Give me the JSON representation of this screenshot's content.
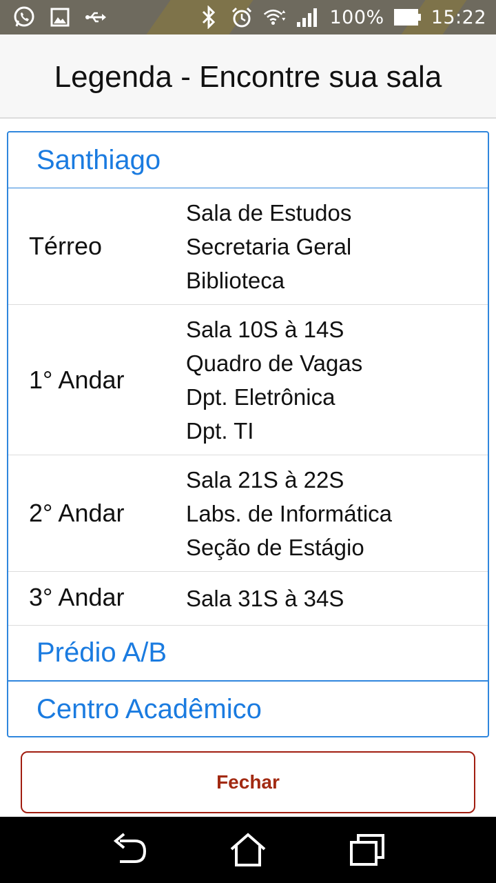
{
  "status_bar": {
    "icons_left": [
      "whatsapp-icon",
      "image-icon",
      "usb-icon"
    ],
    "icons_right": [
      "bluetooth-icon",
      "alarm-icon",
      "wifi-icon",
      "signal-icon",
      "battery-icon"
    ],
    "battery_percent": "100%",
    "time": "15:22"
  },
  "header": {
    "title": "Legenda - Encontre sua sala"
  },
  "accordion": {
    "sections": [
      {
        "title": "Santhiago",
        "expanded": true,
        "floors": [
          {
            "name": "Térreo",
            "rooms": [
              "Sala de Estudos",
              "Secretaria Geral",
              "Biblioteca"
            ]
          },
          {
            "name": "1° Andar",
            "rooms": [
              "Sala 10S à 14S",
              "Quadro de Vagas",
              "Dpt. Eletrônica",
              "Dpt. TI"
            ]
          },
          {
            "name": "2° Andar",
            "rooms": [
              "Sala 21S à 22S",
              "Labs. de Informática",
              "Seção de Estágio"
            ]
          },
          {
            "name": "3° Andar",
            "rooms": [
              "Sala 31S à 34S"
            ]
          }
        ]
      },
      {
        "title": "Prédio A/B",
        "expanded": false
      },
      {
        "title": "Centro Acadêmico",
        "expanded": false
      }
    ]
  },
  "close_button": {
    "label": "Fechar"
  },
  "nav_bar": {
    "icons": [
      "back-icon",
      "home-icon",
      "recent-apps-icon"
    ]
  },
  "colors": {
    "accent_blue": "#1a7be0",
    "close_red": "#a22a12",
    "status_bar_bg": "#6e6a5e",
    "nav_bar_bg": "#000000"
  }
}
